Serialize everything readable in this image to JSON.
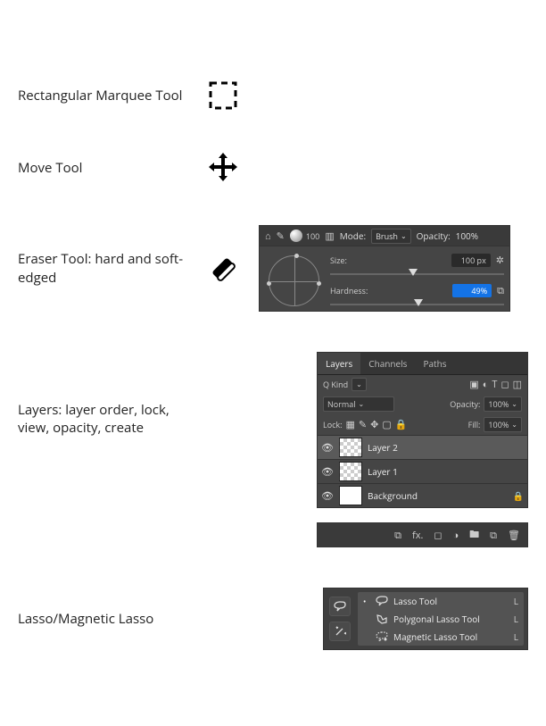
{
  "rows": {
    "marquee": {
      "label": "Rectangular Marquee Tool"
    },
    "move": {
      "label": "Move Tool"
    },
    "eraser": {
      "label": "Eraser Tool: hard and soft-edged"
    },
    "layers": {
      "label": "Layers: layer order, lock, view, opacity, create"
    },
    "lasso": {
      "label": "Lasso/Magnetic Lasso"
    }
  },
  "eraser_panel": {
    "brush_number": "100",
    "mode_label": "Mode:",
    "mode_value": "Brush",
    "opacity_label": "Opacity:",
    "opacity_value": "100%",
    "size_label": "Size:",
    "size_value": "100 px",
    "hardness_label": "Hardness:",
    "hardness_value": "49%"
  },
  "layers_panel": {
    "tabs": {
      "layers": "Layers",
      "channels": "Channels",
      "paths": "Paths"
    },
    "kind_label": "Q Kind",
    "blend_mode": "Normal",
    "opacity_label": "Opacity:",
    "opacity_value": "100%",
    "lock_label": "Lock:",
    "fill_label": "Fill:",
    "fill_value": "100%",
    "layers": [
      {
        "name": "Layer 2",
        "selected": true,
        "checker": true,
        "locked": false
      },
      {
        "name": "Layer 1",
        "selected": false,
        "checker": true,
        "locked": false
      },
      {
        "name": "Background",
        "selected": false,
        "checker": false,
        "locked": true
      }
    ]
  },
  "lasso_panel": {
    "items": [
      {
        "name": "Lasso Tool",
        "key": "L",
        "active": true
      },
      {
        "name": "Polygonal Lasso Tool",
        "key": "L",
        "active": false
      },
      {
        "name": "Magnetic Lasso Tool",
        "key": "L",
        "active": false
      }
    ]
  }
}
